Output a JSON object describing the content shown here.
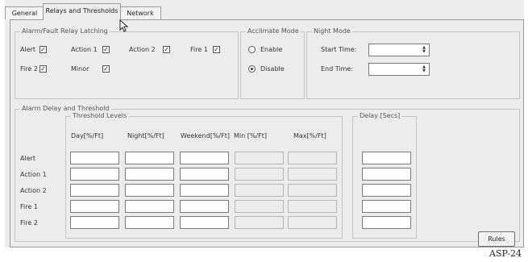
{
  "tabs": [
    {
      "label": "General"
    },
    {
      "label": "Relays and Thresholds"
    },
    {
      "label": "Network"
    }
  ],
  "latching": {
    "title": "Alarm/Fault Relay Latching",
    "items": [
      {
        "label": "Alert",
        "checked": true
      },
      {
        "label": "Action 1",
        "checked": true
      },
      {
        "label": "Action 2",
        "checked": true
      },
      {
        "label": "Fire 1",
        "checked": true
      },
      {
        "label": "Fire 2",
        "checked": true
      },
      {
        "label": "Minor",
        "checked": true
      }
    ]
  },
  "acclimate": {
    "title": "Acclimate Mode",
    "options": [
      {
        "label": "Enable",
        "selected": false
      },
      {
        "label": "Disable",
        "selected": true
      }
    ]
  },
  "night": {
    "title": "Night Mode",
    "start_label": "Start Time:",
    "end_label": "End Time:",
    "start_value": "",
    "end_value": ""
  },
  "delay_threshold": {
    "title": "Alarm Delay and Threshold",
    "threshold_title": "Threshold Levels",
    "columns": [
      "Day[%/Ft]",
      "Night[%/Ft]",
      "Weekend[%/Ft]",
      "Min [%/Ft]",
      "Max[%/Ft]"
    ],
    "delay_title": "Delay [Secs]",
    "rows": [
      "Alert",
      "Action 1",
      "Action 2",
      "Fire 1",
      "Fire 2"
    ]
  },
  "rules_button": "Rules",
  "figure_caption": "ASP-24",
  "icons": {
    "check": "✓",
    "spin_up": "▲",
    "spin_down": "▼"
  }
}
